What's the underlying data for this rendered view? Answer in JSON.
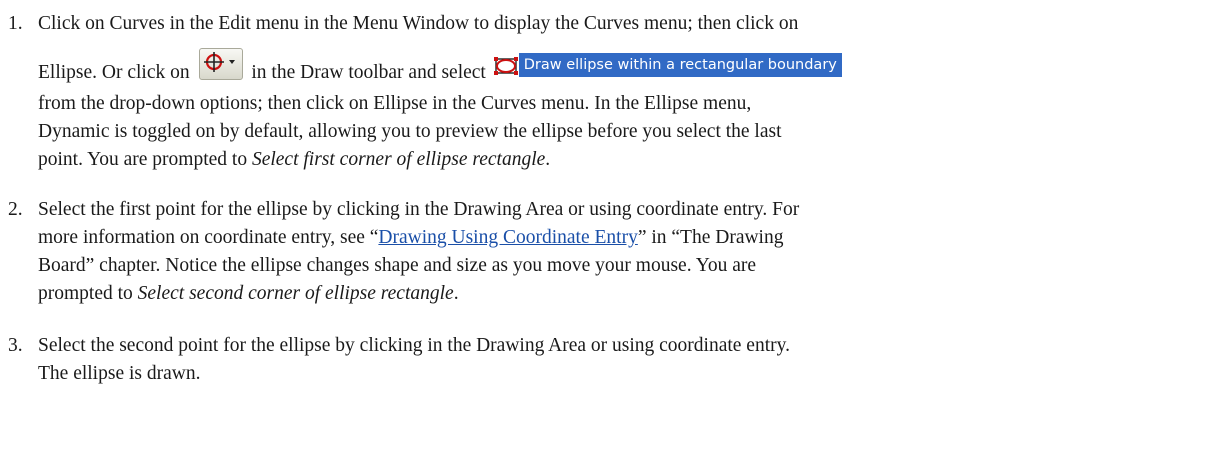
{
  "steps": [
    {
      "number": "1.",
      "line1": "Click on Curves in the Edit menu in the Menu Window to display the Curves menu; then click on",
      "line2_part1": "Ellipse. Or click on",
      "line2_part2": "in the Draw toolbar and select",
      "toolbar_button_icon": "ellipse-crosshair-dropdown-icon",
      "dropdown_option_icon": "ellipse-rectangle-boundary-icon",
      "dropdown_option_label": "Draw ellipse within a rectangular boundary",
      "line3": "from the drop-down options; then click on Ellipse in the Curves menu. In the Ellipse menu,",
      "line4": "Dynamic is toggled on by default, allowing you to preview the ellipse before you select the last",
      "line5_part1": "point. You are prompted to",
      "line5_italic": "Select first corner of ellipse rectangle",
      "line5_end": "."
    },
    {
      "number": "2.",
      "line1": "Select the first point for the ellipse by clicking in the Drawing Area or using coordinate entry. For",
      "line2_part1": "more information on coordinate entry, see “",
      "line2_link": "Drawing Using Coordinate Entry",
      "line2_part2": "” in “The Drawing",
      "line3": "Board” chapter. Notice the ellipse changes shape and size as you move your mouse. You are",
      "line4_part1": "prompted to",
      "line4_italic": "Select second corner of ellipse rectangle",
      "line4_end": "."
    },
    {
      "number": "3.",
      "line1": "Select the second point for the ellipse by clicking in the Drawing Area or using coordinate entry.",
      "line2": "The ellipse is drawn."
    }
  ],
  "colors": {
    "link": "#1a4fa8",
    "highlight": "#316ac5",
    "icon_red": "#cc1111"
  }
}
